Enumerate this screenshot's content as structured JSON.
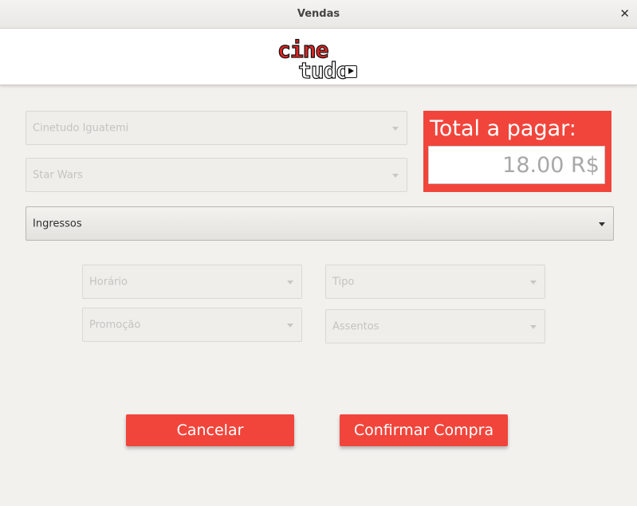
{
  "window": {
    "title": "Vendas",
    "close_glyph": "✕"
  },
  "logo": {
    "line1": "cine",
    "line2": "tudo",
    "icon": "play-icon"
  },
  "filters": {
    "cinema": "Cinetudo Iguatemi",
    "movie": "Star Wars",
    "category": "Ingressos",
    "horario": "Horário",
    "tipo": "Tipo",
    "promocao": "Promoção",
    "assentos": "Assentos"
  },
  "total": {
    "label": "Total a pagar:",
    "amount": "18.00 R$"
  },
  "actions": {
    "cancel": "Cancelar",
    "confirm": "Confirmar Compra"
  },
  "colors": {
    "accent": "#f1453b",
    "background": "#f2f1ee",
    "disabled_text": "#c4c3c0"
  }
}
